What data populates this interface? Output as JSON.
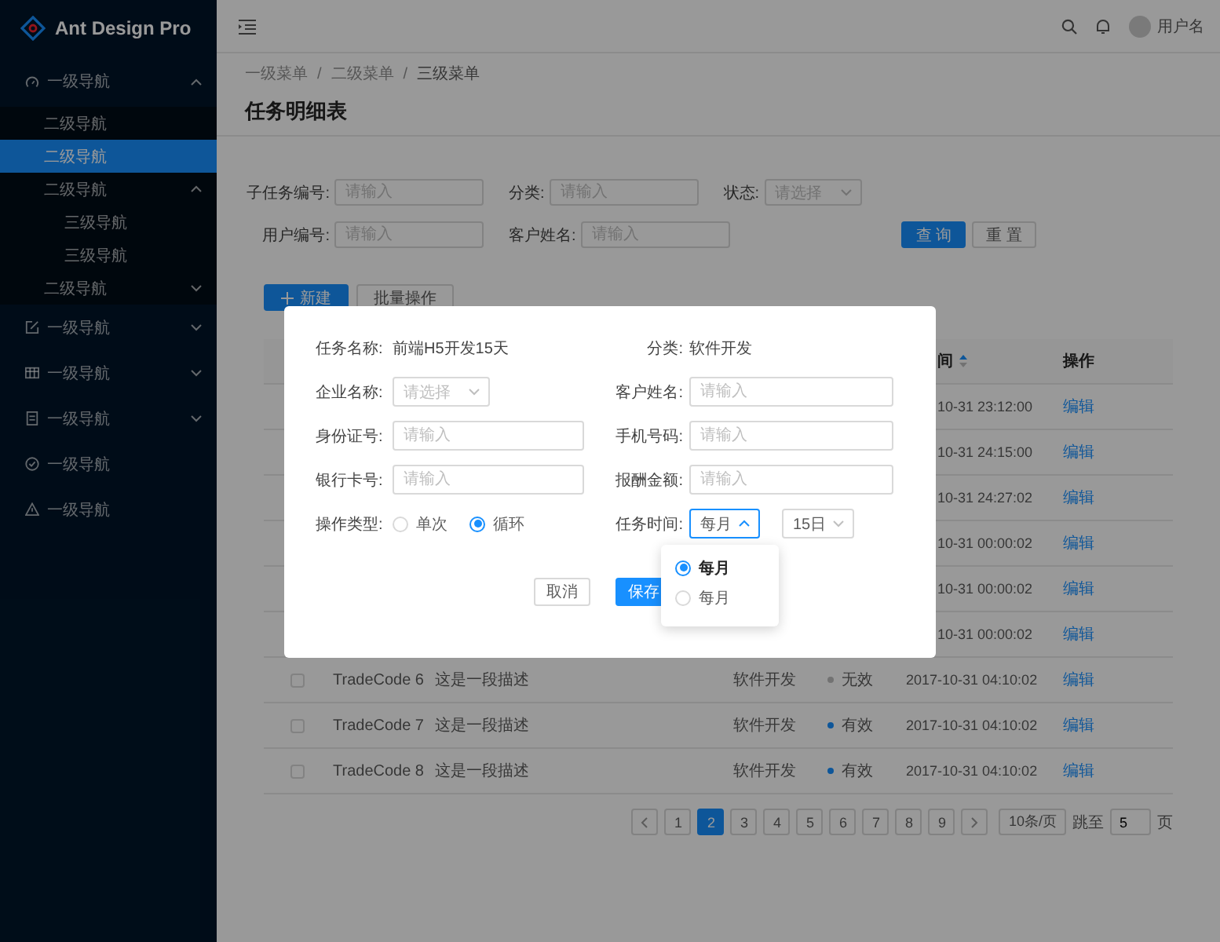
{
  "sidebar": {
    "logo": "Ant Design Pro",
    "items": [
      {
        "label": "一级导航",
        "selected": false,
        "expanded": true,
        "children": [
          {
            "label": "二级导航",
            "selected": false
          },
          {
            "label": "二级导航",
            "selected": true
          },
          {
            "label": "二级导航",
            "selected": false,
            "expanded": true,
            "children": [
              {
                "label": "三级导航",
                "selected": false
              },
              {
                "label": "三级导航",
                "selected": false
              }
            ]
          },
          {
            "label": "二级导航",
            "selected": false,
            "expanded": false
          }
        ]
      },
      {
        "label": "一级导航",
        "selected": false,
        "expanded": false
      },
      {
        "label": "一级导航",
        "selected": false,
        "expanded": false
      },
      {
        "label": "一级导航",
        "selected": false,
        "expanded": false
      },
      {
        "label": "一级导航",
        "selected": false
      },
      {
        "label": "一级导航",
        "selected": false
      }
    ]
  },
  "header": {
    "user": "用户名"
  },
  "breadcrumb": [
    {
      "label": "一级菜单",
      "separator": "/"
    },
    {
      "label": "二级菜单",
      "separator": "/"
    },
    {
      "label": "三级菜单"
    }
  ],
  "page_title": "任务明细表",
  "search_form": {
    "fields": [
      {
        "kind": "input",
        "label": "子任务编号:",
        "placeholder": "请输入"
      },
      {
        "kind": "input",
        "label": "分类:",
        "placeholder": "请输入"
      },
      {
        "kind": "select",
        "label": "状态:",
        "placeholder": "请选择"
      },
      {
        "kind": "input",
        "label": "用户编号:",
        "placeholder": "请输入"
      },
      {
        "kind": "input",
        "label": "客户姓名:",
        "placeholder": "请输入"
      }
    ],
    "buttons": [
      {
        "label": "查 询",
        "kind": "primary"
      },
      {
        "label": "重 置",
        "kind": "default"
      }
    ]
  },
  "toolbar": [
    {
      "label": "新建",
      "kind": "primary"
    },
    {
      "label": "批量操作",
      "kind": "default"
    }
  ],
  "table": {
    "columns": [
      {
        "label": "间",
        "sorted_ascending": true
      },
      {
        "label": "操作"
      }
    ],
    "hidden_rows": [
      {
        "time": "10-31 23:12:00",
        "action": "编辑"
      },
      {
        "time": "10-31 24:15:00",
        "action": "编辑"
      },
      {
        "time": "10-31 24:27:02",
        "action": "编辑"
      },
      {
        "time": "10-31 00:00:02",
        "action": "编辑"
      },
      {
        "time": "10-31 00:00:02",
        "action": "编辑"
      },
      {
        "time": "10-31 00:00:02",
        "action": "编辑"
      }
    ],
    "rows": [
      {
        "checked": false,
        "code": "TradeCode 6",
        "description": "这是一段描述",
        "category": "软件开发",
        "status": "无效",
        "active": false,
        "time": "2017-10-31 04:10:02",
        "action": "编辑"
      },
      {
        "checked": false,
        "code": "TradeCode 7",
        "description": "这是一段描述",
        "category": "软件开发",
        "status": "有效",
        "active": true,
        "time": "2017-10-31 04:10:02",
        "action": "编辑"
      },
      {
        "checked": false,
        "code": "TradeCode 8",
        "description": "这是一段描述",
        "category": "软件开发",
        "status": "有效",
        "active": true,
        "time": "2017-10-31 04:10:02",
        "action": "编辑"
      }
    ]
  },
  "pagination": {
    "pages": [
      {
        "label": "1",
        "selected": false
      },
      {
        "label": "2",
        "selected": true
      },
      {
        "label": "3",
        "selected": false
      },
      {
        "label": "4",
        "selected": false
      },
      {
        "label": "5",
        "selected": false
      },
      {
        "label": "6",
        "selected": false
      },
      {
        "label": "7",
        "selected": false
      },
      {
        "label": "8",
        "selected": false
      },
      {
        "label": "9",
        "selected": false
      }
    ],
    "page_size": "10条/页",
    "jump_label": "跳至",
    "jump_value": "5",
    "page_suffix": "页"
  },
  "modal": {
    "fields": [
      {
        "kind": "text",
        "label": "任务名称:",
        "value": "前端H5开发15天"
      },
      {
        "kind": "text",
        "label": "分类:",
        "value": "软件开发"
      },
      {
        "kind": "select",
        "label": "企业名称:",
        "placeholder": "请选择"
      },
      {
        "kind": "input",
        "label": "客户姓名:",
        "placeholder": "请输入"
      },
      {
        "kind": "input",
        "label": "身份证号:",
        "placeholder": "请输入"
      },
      {
        "kind": "input",
        "label": "手机号码:",
        "placeholder": "请输入"
      },
      {
        "kind": "input",
        "label": "银行卡号:",
        "placeholder": "请输入"
      },
      {
        "kind": "input",
        "label": "报酬金额:",
        "placeholder": "请输入"
      },
      {
        "kind": "radio",
        "label": "操作类型:",
        "options": [
          {
            "label": "单次",
            "selected": false
          },
          {
            "label": "循环",
            "selected": true
          }
        ]
      },
      {
        "kind": "schedule",
        "label": "任务时间:",
        "selects": [
          {
            "value": "每月",
            "expanded": true
          },
          {
            "value": "15日",
            "expanded": false
          }
        ]
      }
    ],
    "buttons": [
      {
        "label": "取消",
        "kind": "default"
      },
      {
        "label": "保存",
        "kind": "primary"
      }
    ],
    "dropdown": [
      {
        "label": "每月",
        "selected": true
      },
      {
        "label": "每月",
        "selected": false
      }
    ]
  }
}
